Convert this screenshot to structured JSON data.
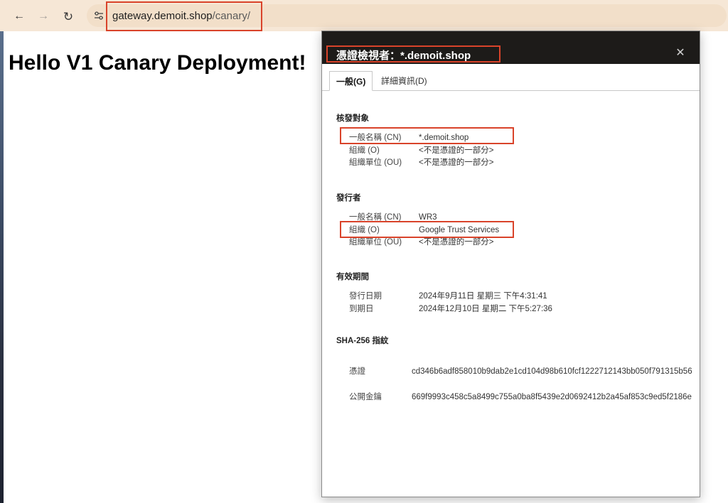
{
  "browser": {
    "back_icon": "←",
    "forward_icon": "→",
    "reload_icon": "↻",
    "url_host": "gateway.demoit.shop",
    "url_path": "/canary/"
  },
  "page": {
    "heading": "Hello V1 Canary Deployment!"
  },
  "dialog": {
    "title": "憑證檢視者：*.demoit.shop",
    "close_icon": "✕",
    "tabs": [
      {
        "label": "一般(G)",
        "active": true
      },
      {
        "label": "詳細資訊(D)",
        "active": false
      }
    ],
    "subject": {
      "title": "核發對象",
      "rows": [
        {
          "key": "一般名稱 (CN)",
          "value": "*.demoit.shop"
        },
        {
          "key": "組織 (O)",
          "value": "<不是憑證的一部分>"
        },
        {
          "key": "組織單位 (OU)",
          "value": "<不是憑證的一部分>"
        }
      ]
    },
    "issuer": {
      "title": "發行者",
      "rows": [
        {
          "key": "一般名稱 (CN)",
          "value": "WR3"
        },
        {
          "key": "組織 (O)",
          "value": "Google Trust Services"
        },
        {
          "key": "組織單位 (OU)",
          "value": "<不是憑證的一部分>"
        }
      ]
    },
    "validity": {
      "title": "有效期間",
      "rows": [
        {
          "key": "發行日期",
          "value": "2024年9月11日 星期三 下午4:31:41"
        },
        {
          "key": "到期日",
          "value": "2024年12月10日 星期二 下午5:27:36"
        }
      ]
    },
    "fingerprints": {
      "title": "SHA-256 指紋",
      "rows": [
        {
          "key": "憑證",
          "value": "cd346b6adf858010b9dab2e1cd104d98b610fcf1222712143bb050f791315b56"
        },
        {
          "key": "公開金鑰",
          "value": "669f9993c458c5a8499c755a0ba8f5439e2d0692412b2a45af853c9ed5f2186e"
        }
      ]
    }
  },
  "colors": {
    "toolbar_bg": "#f6e7d6",
    "dialog_header_bg": "#1d1b19",
    "highlight_border": "#d9432a"
  }
}
